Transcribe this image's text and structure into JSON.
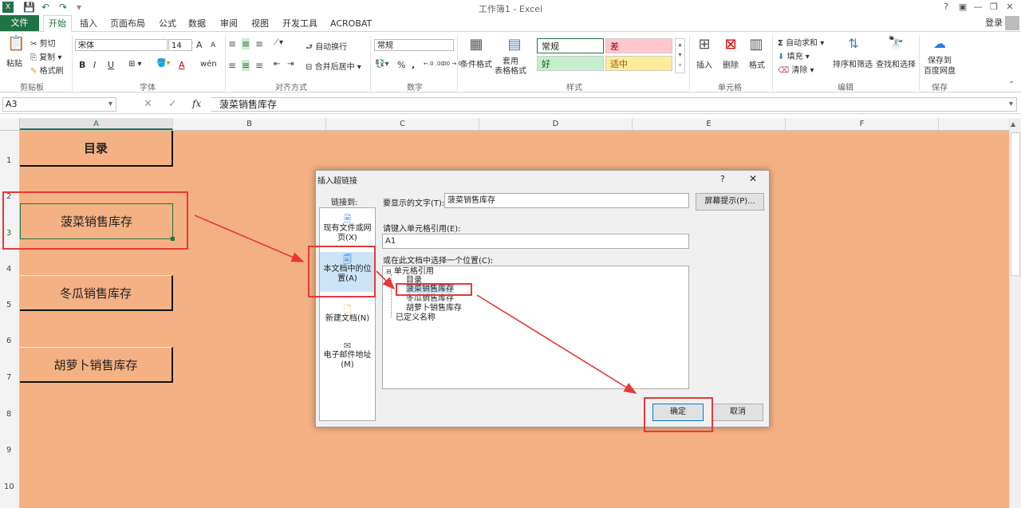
{
  "window": {
    "title": "工作簿1 - Excel",
    "help": "?",
    "login": "登录"
  },
  "tabs": [
    "文件",
    "开始",
    "插入",
    "页面布局",
    "公式",
    "数据",
    "审阅",
    "视图",
    "开发工具",
    "ACROBAT"
  ],
  "ribbon": {
    "clipboard": {
      "paste": "粘贴",
      "cut": "剪切",
      "copy": "复制",
      "format_painter": "格式刷",
      "label": "剪贴板"
    },
    "font": {
      "name": "宋体",
      "size": "14",
      "label": "字体",
      "bold": "B",
      "italic": "I",
      "underline": "U",
      "grow": "A",
      "shrink": "A",
      "color_a": "A",
      "phonetic": "wén"
    },
    "alignment": {
      "wrap": "自动换行",
      "merge": "合并后居中",
      "label": "对齐方式"
    },
    "number": {
      "format": "常规",
      "percent": "%",
      "comma": ",",
      "inc": "←.0 .00",
      "dec": ".00 →.0",
      "label": "数字"
    },
    "styles": {
      "cond": "条件格式",
      "table": "套用\n表格格式",
      "normal": "常规",
      "bad": "差",
      "good": "好",
      "neutral": "适中",
      "label": "样式"
    },
    "cells": {
      "insert": "插入",
      "delete": "删除",
      "format": "格式",
      "label": "单元格"
    },
    "editing": {
      "autosum": "自动求和",
      "fill": "填充",
      "clear": "清除",
      "sort": "排序和筛选",
      "find": "查找和选择",
      "label": "编辑"
    },
    "save": {
      "save_to": "保存到\n百度网盘",
      "label": "保存"
    }
  },
  "formula_bar": {
    "name_box": "A3",
    "fx": "fx",
    "value": "菠菜销售库存"
  },
  "columns": [
    "A",
    "B",
    "C",
    "D",
    "E",
    "F"
  ],
  "rows": [
    "1",
    "2",
    "3",
    "4",
    "5",
    "6",
    "7",
    "8",
    "9",
    "10"
  ],
  "cells": {
    "a1": "目录",
    "a3": "菠菜销售库存",
    "a5": "冬瓜销售库存",
    "a7": "胡萝卜销售库存"
  },
  "dialog": {
    "title": "插入超链接",
    "help": "?",
    "close": "✕",
    "link_to": "链接到:",
    "link_items": [
      {
        "label": "现有文件或网页(X)"
      },
      {
        "label": "本文档中的位置(A)"
      },
      {
        "label": "新建文档(N)"
      },
      {
        "label": "电子邮件地址(M)"
      }
    ],
    "display_text_label": "要显示的文字(T):",
    "display_text_value": "菠菜销售库存",
    "screentip": "屏幕提示(P)...",
    "cell_ref_label": "请键入单元格引用(E):",
    "cell_ref_value": "A1",
    "place_label": "或在此文档中选择一个位置(C):",
    "tree": {
      "root": "单元格引用",
      "children": [
        "目录",
        "菠菜销售库存",
        "冬瓜销售库存",
        "胡萝卜销售库存"
      ],
      "defined_names": "已定义名称"
    },
    "ok": "确定",
    "cancel": "取消"
  },
  "colors": {
    "excel_green": "#217346",
    "sheet_fill": "#f4b183",
    "highlight_red": "#e53935",
    "selection": "#0078d7"
  }
}
